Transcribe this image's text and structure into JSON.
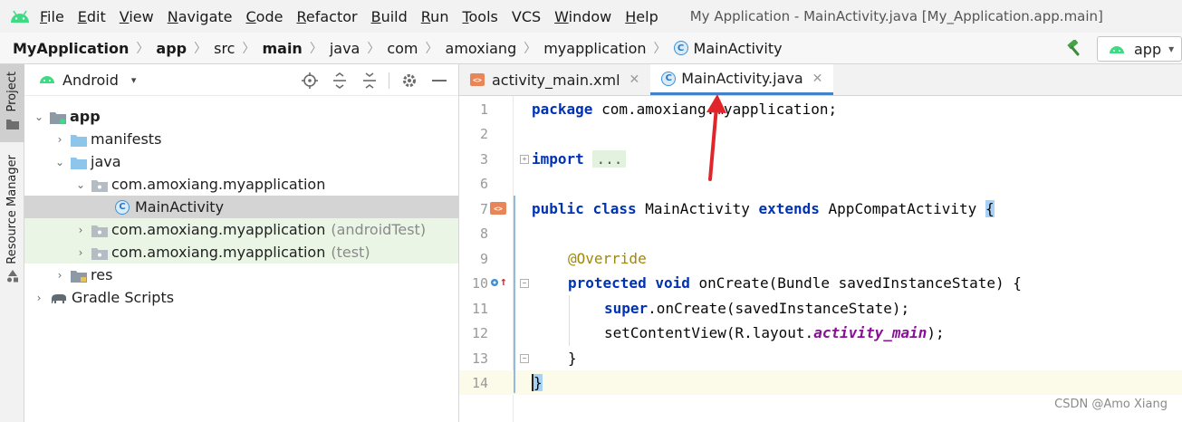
{
  "menu": {
    "items": [
      {
        "mn": "F",
        "rest": "ile"
      },
      {
        "mn": "E",
        "rest": "dit"
      },
      {
        "mn": "V",
        "rest": "iew"
      },
      {
        "mn": "N",
        "rest": "avigate"
      },
      {
        "mn": "C",
        "rest": "ode"
      },
      {
        "mn": "R",
        "rest": "efactor"
      },
      {
        "mn": "B",
        "rest": "uild"
      },
      {
        "mn": "R",
        "rest": "un"
      },
      {
        "mn": "T",
        "rest": "ools"
      },
      {
        "mn": "",
        "rest": "VCS"
      },
      {
        "mn": "W",
        "rest": "indow"
      },
      {
        "mn": "H",
        "rest": "elp"
      }
    ],
    "window_title": "My Application - MainActivity.java [My_Application.app.main]"
  },
  "breadcrumb": {
    "items": [
      "MyApplication",
      "app",
      "src",
      "main",
      "java",
      "com",
      "amoxiang",
      "myapplication"
    ],
    "current": "MainActivity",
    "class_icon": "C",
    "separator": "〉"
  },
  "toolbar": {
    "run_config": "app",
    "run_config_dropdown": "▾"
  },
  "toolstrip": {
    "project_label": "Project",
    "resource_manager_label": "Resource Manager"
  },
  "project_panel": {
    "view_label": "Android",
    "dropdown": "▾",
    "tree": {
      "app": "app",
      "manifests": "manifests",
      "java": "java",
      "pkg_main": "com.amoxiang.myapplication",
      "main_activity": "MainActivity",
      "pkg_android_test": "com.amoxiang.myapplication",
      "android_test_suffix": "(androidTest)",
      "pkg_test": "com.amoxiang.myapplication",
      "test_suffix": "(test)",
      "res": "res",
      "gradle_scripts": "Gradle Scripts"
    },
    "arrow_expanded": "⌄",
    "arrow_collapsed": "›",
    "class_icon": "C"
  },
  "editor": {
    "tabs": [
      {
        "label": "activity_main.xml",
        "icon": "xml-file-icon",
        "icon_text": "<>",
        "close": "✕"
      },
      {
        "label": "MainActivity.java",
        "icon": "class-icon",
        "icon_text": "C",
        "close": "✕"
      }
    ],
    "line_numbers": [
      "1",
      "2",
      "3",
      "6",
      "7",
      "8",
      "9",
      "10",
      "11",
      "12",
      "13",
      "14"
    ],
    "code": {
      "l1_kw": "package",
      "l1_rest": " com.amoxiang.myapplication;",
      "l3_kw": "import",
      "l3_fold": "...",
      "l7_kw1": "public",
      "l7_kw2": "class",
      "l7_name": " MainActivity ",
      "l7_kw3": "extends",
      "l7_base": " AppCompatActivity ",
      "l7_brace": "{",
      "l9_ann": "@Override",
      "l10_kw1": "protected",
      "l10_kw2": "void",
      "l10_rest": " onCreate(Bundle savedInstanceState) {",
      "l11_kw": "super",
      "l11_rest": ".onCreate(savedInstanceState);",
      "l12_pre": "setContentView(R.layout.",
      "l12_ital": "activity_main",
      "l12_post": ");",
      "l13": "}",
      "l14": "}"
    },
    "gutter_icons": {
      "xml_icon_text": "<>",
      "override_marker": "↑"
    }
  },
  "watermark": "CSDN @Amo Xiang",
  "colors": {
    "keyword": "#0033b3",
    "annotation": "#9e880d",
    "italic_field": "#871094",
    "tab_underline": "#4083c9",
    "android_green": "#3ddc84",
    "highlight_arrow": "#e0262b"
  }
}
